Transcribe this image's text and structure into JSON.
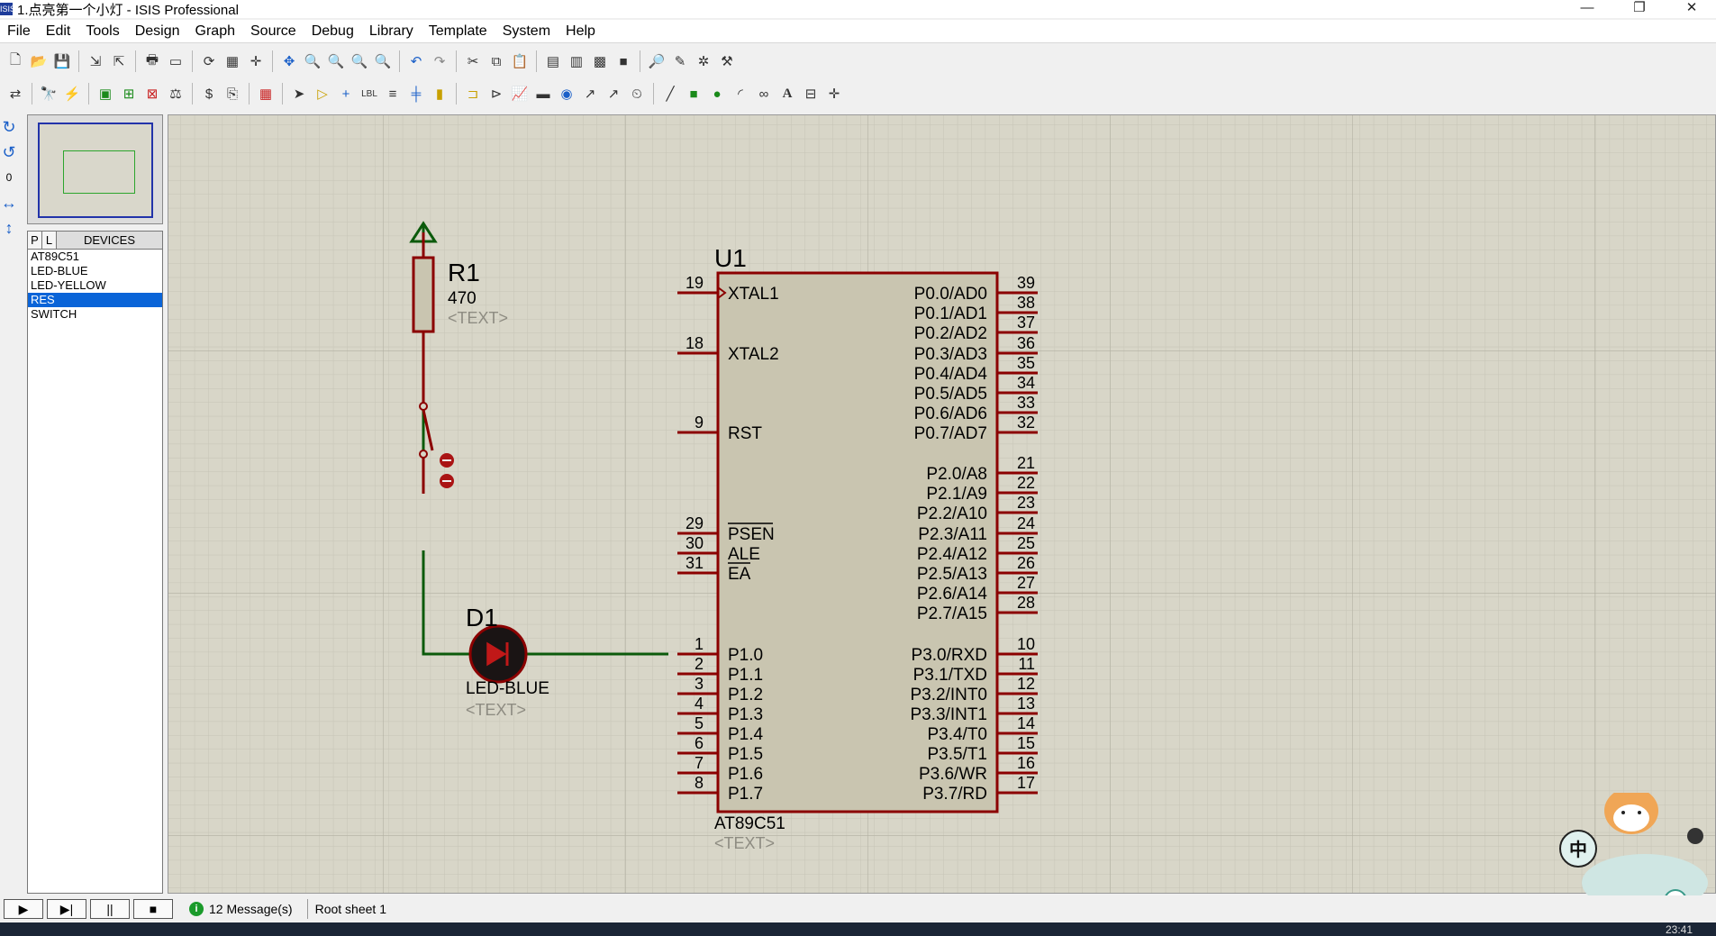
{
  "window": {
    "title": "1.点亮第一个小灯 - ISIS Professional",
    "app_icon": "ISIS",
    "controls": [
      "—",
      "❐",
      "✕"
    ]
  },
  "menu": [
    "File",
    "Edit",
    "Tools",
    "Design",
    "Graph",
    "Source",
    "Debug",
    "Library",
    "Template",
    "System",
    "Help"
  ],
  "toolbar1_icons": [
    "new-icon",
    "open-icon",
    "save-icon",
    "import-icon",
    "export-icon",
    "print-icon",
    "print-area-icon",
    "refresh-icon",
    "grid-icon",
    "origin-icon",
    "pan-icon",
    "zoom-in-icon",
    "zoom-out-icon",
    "zoom-all-icon",
    "zoom-area-icon",
    "undo-icon",
    "redo-icon",
    "cut-icon",
    "copy-icon",
    "paste-icon",
    "block-copy-icon",
    "block-move-icon",
    "block-rotate-icon",
    "block-delete-icon",
    "pick-device-icon",
    "make-device-icon",
    "package-icon",
    "decompose-icon"
  ],
  "toolbar2_icons": [
    "wire-autorouter-icon",
    "search-icon",
    "property-assign-icon",
    "new-sheet-icon",
    "remove-sheet-icon",
    "exit-parent-icon",
    "bom-icon",
    "erc-icon",
    "netlist-icon",
    "ares-icon",
    "select-icon",
    "component-icon",
    "junction-icon",
    "wire-label-icon",
    "text-script-icon",
    "bus-icon",
    "subcircuit-icon",
    "terminal-icon",
    "pin-icon",
    "graph-icon",
    "tape-icon",
    "generator-icon",
    "voltage-probe-icon",
    "current-probe-icon",
    "instrument-icon",
    "line-icon",
    "box-icon",
    "circle-icon",
    "arc-icon",
    "path-icon",
    "text-icon",
    "symbol-icon",
    "marker-icon"
  ],
  "left_tools": [
    "↻",
    "↺",
    "0",
    "↔",
    "↕"
  ],
  "device_panel": {
    "tab_p": "P",
    "tab_l": "L",
    "header": "DEVICES",
    "items": [
      "AT89C51",
      "LED-BLUE",
      "LED-YELLOW",
      "RES",
      "SWITCH"
    ],
    "selected_index": 3
  },
  "schematic": {
    "u1": {
      "ref": "U1",
      "part": "AT89C51",
      "text": "<TEXT>",
      "left_pins": [
        {
          "num": "19",
          "name": "XTAL1"
        },
        {
          "num": "18",
          "name": "XTAL2"
        },
        {
          "num": "9",
          "name": "RST"
        },
        {
          "num": "29",
          "name": "PSEN"
        },
        {
          "num": "30",
          "name": "ALE"
        },
        {
          "num": "31",
          "name": "EA"
        },
        {
          "num": "1",
          "name": "P1.0"
        },
        {
          "num": "2",
          "name": "P1.1"
        },
        {
          "num": "3",
          "name": "P1.2"
        },
        {
          "num": "4",
          "name": "P1.3"
        },
        {
          "num": "5",
          "name": "P1.4"
        },
        {
          "num": "6",
          "name": "P1.5"
        },
        {
          "num": "7",
          "name": "P1.6"
        },
        {
          "num": "8",
          "name": "P1.7"
        }
      ],
      "right_pins": [
        {
          "num": "39",
          "name": "P0.0/AD0"
        },
        {
          "num": "38",
          "name": "P0.1/AD1"
        },
        {
          "num": "37",
          "name": "P0.2/AD2"
        },
        {
          "num": "36",
          "name": "P0.3/AD3"
        },
        {
          "num": "35",
          "name": "P0.4/AD4"
        },
        {
          "num": "34",
          "name": "P0.5/AD5"
        },
        {
          "num": "33",
          "name": "P0.6/AD6"
        },
        {
          "num": "32",
          "name": "P0.7/AD7"
        },
        {
          "num": "21",
          "name": "P2.0/A8"
        },
        {
          "num": "22",
          "name": "P2.1/A9"
        },
        {
          "num": "23",
          "name": "P2.2/A10"
        },
        {
          "num": "24",
          "name": "P2.3/A11"
        },
        {
          "num": "25",
          "name": "P2.4/A12"
        },
        {
          "num": "26",
          "name": "P2.5/A13"
        },
        {
          "num": "27",
          "name": "P2.6/A14"
        },
        {
          "num": "28",
          "name": "P2.7/A15"
        },
        {
          "num": "10",
          "name": "P3.0/RXD"
        },
        {
          "num": "11",
          "name": "P3.1/TXD"
        },
        {
          "num": "12",
          "name": "P3.2/INT0"
        },
        {
          "num": "13",
          "name": "P3.3/INT1"
        },
        {
          "num": "14",
          "name": "P3.4/T0"
        },
        {
          "num": "15",
          "name": "P3.5/T1"
        },
        {
          "num": "16",
          "name": "P3.6/WR"
        },
        {
          "num": "17",
          "name": "P3.7/RD"
        }
      ]
    },
    "r1": {
      "ref": "R1",
      "value": "470",
      "text": "<TEXT>"
    },
    "d1": {
      "ref": "D1",
      "part": "LED-BLUE",
      "text": "<TEXT>"
    }
  },
  "status": {
    "sim_buttons": [
      "▶",
      "▶|",
      "||",
      "■"
    ],
    "messages": "12 Message(s)",
    "sheet": "Root sheet 1"
  },
  "assistant_badge": "中",
  "clock": "23:41",
  "colors": {
    "canvas": "#d8d6c8",
    "grid": "#c4c2b4",
    "component_body": "#c9c5b0",
    "component_outline": "#8b0000",
    "wire": "#0b5a0b",
    "selected": "#0a64d8"
  }
}
